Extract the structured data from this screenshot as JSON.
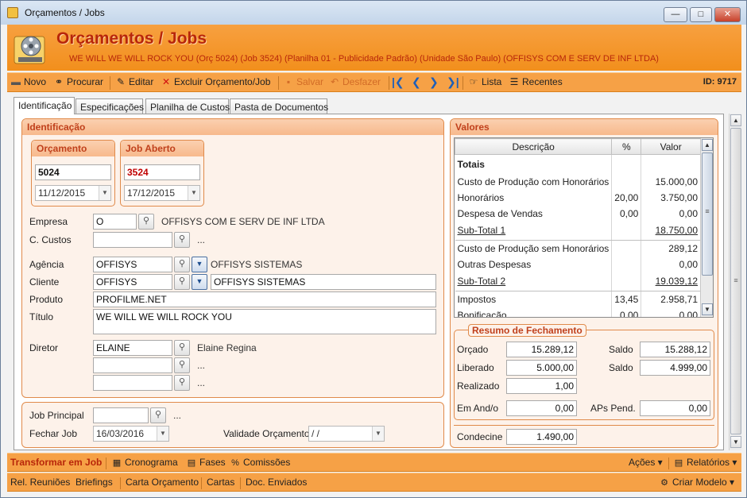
{
  "window": {
    "title": "Orçamentos / Jobs",
    "min_glyph": "—",
    "max_glyph": "□",
    "close_glyph": "✕"
  },
  "header": {
    "title": "Orçamentos / Jobs",
    "subtitle": "WE WILL WE WILL ROCK YOU (Orç 5024) (Job 3524)  (Planilha 01 - Publicidade Padrão) (Unidade São Paulo) (OFFISYS COM E SERV DE INF LTDA)"
  },
  "toolbar": {
    "novo": "Novo",
    "procurar": "Procurar",
    "editar": "Editar",
    "excluir": "Excluir Orçamento/Job",
    "salvar": "Salvar",
    "desfazer": "Desfazer",
    "lista": "Lista",
    "recentes": "Recentes",
    "id": "ID: 9717"
  },
  "tabs": [
    {
      "label": "Identificação"
    },
    {
      "label": "Especificações"
    },
    {
      "label": "Planilha de Custos"
    },
    {
      "label": "Pasta de Documentos"
    }
  ],
  "identificacao": {
    "title": "Identificação",
    "orcamento": {
      "title": "Orçamento",
      "number": "5024",
      "date": "11/12/2015"
    },
    "job": {
      "title": "Job Aberto",
      "number": "3524",
      "date": "17/12/2015"
    },
    "empresa": {
      "label": "Empresa",
      "code": "O",
      "name": "OFFISYS COM E SERV DE INF LTDA"
    },
    "ccustos": {
      "label": "C. Custos",
      "code": "",
      "name": "..."
    },
    "agencia": {
      "label": "Agência",
      "code": "OFFISYS",
      "name": "OFFISYS SISTEMAS"
    },
    "cliente": {
      "label": "Cliente",
      "code": "OFFISYS",
      "name": "OFFISYS SISTEMAS"
    },
    "produto": {
      "label": "Produto",
      "value": "PROFILME.NET"
    },
    "titulo": {
      "label": "Título",
      "value": "WE WILL WE WILL ROCK YOU"
    },
    "diretor": {
      "label": "Diretor",
      "code": "ELAINE",
      "name": "Elaine Regina",
      "row2_name": "...",
      "row3_name": "..."
    }
  },
  "job_section": {
    "job_principal": {
      "label": "Job Principal",
      "code": "",
      "name": "..."
    },
    "fechar_job": {
      "label": "Fechar Job",
      "date": "16/03/2016"
    },
    "validade": {
      "label": "Validade Orçamento",
      "date": " /  /"
    }
  },
  "valores": {
    "title": "Valores",
    "columns": [
      "Descrição",
      "%",
      "Valor"
    ],
    "rows": [
      {
        "desc": "Totais",
        "pct": "",
        "valor": "",
        "kind": "tot"
      },
      {
        "desc": "Custo de Produção com Honorários",
        "pct": "",
        "valor": "15.000,00",
        "kind": ""
      },
      {
        "desc": "Honorários",
        "pct": "20,00",
        "valor": "3.750,00",
        "kind": ""
      },
      {
        "desc": "Despesa de Vendas",
        "pct": "0,00",
        "valor": "0,00",
        "kind": ""
      },
      {
        "desc": "Sub-Total 1",
        "pct": "",
        "valor": "18.750,00",
        "kind": "sub"
      },
      {
        "desc": "Custo de Produção sem Honorários",
        "pct": "",
        "valor": "289,12",
        "kind": ""
      },
      {
        "desc": "Outras Despesas",
        "pct": "",
        "valor": "0,00",
        "kind": ""
      },
      {
        "desc": "Sub-Total 2",
        "pct": "",
        "valor": "19.039,12",
        "kind": "sub"
      },
      {
        "desc": "Impostos",
        "pct": "13,45",
        "valor": "2.958,71",
        "kind": ""
      },
      {
        "desc": "Bonificação",
        "pct": "0,00",
        "valor": "0,00",
        "kind": ""
      }
    ]
  },
  "resumo": {
    "title": "Resumo de Fechamento",
    "orcado": {
      "label": "Orçado",
      "value": "15.289,12"
    },
    "saldo1": {
      "label": "Saldo",
      "value": "15.288,12"
    },
    "liberado": {
      "label": "Liberado",
      "value": "5.000,00"
    },
    "saldo2": {
      "label": "Saldo",
      "value": "4.999,00"
    },
    "realizado": {
      "label": "Realizado",
      "value": "1,00"
    },
    "em_andamento": {
      "label": "Em And/o",
      "value": "0,00"
    },
    "aps_pend": {
      "label": "APs Pend.",
      "value": "0,00"
    },
    "condecine": {
      "label": "Condecine",
      "value": "1.490,00"
    }
  },
  "bottombar1": {
    "transformar": "Transformar em Job",
    "cronograma": "Cronograma",
    "fases": "Fases",
    "comissoes": "Comissões",
    "acoes": "Ações ▾",
    "relatorios": "Relatórios ▾"
  },
  "bottombar2": {
    "rel_reunioes": "Rel. Reuniões",
    "briefings": "Briefings",
    "carta_orcamento": "Carta Orçamento",
    "cartas": "Cartas",
    "doc_enviados": "Doc. Enviados",
    "criar_modelo": "Criar Modelo ▾"
  },
  "colors": {
    "accent_orange": "#f28f1c",
    "header_text": "#b8260a",
    "link_blue": "#1f5fb8"
  }
}
